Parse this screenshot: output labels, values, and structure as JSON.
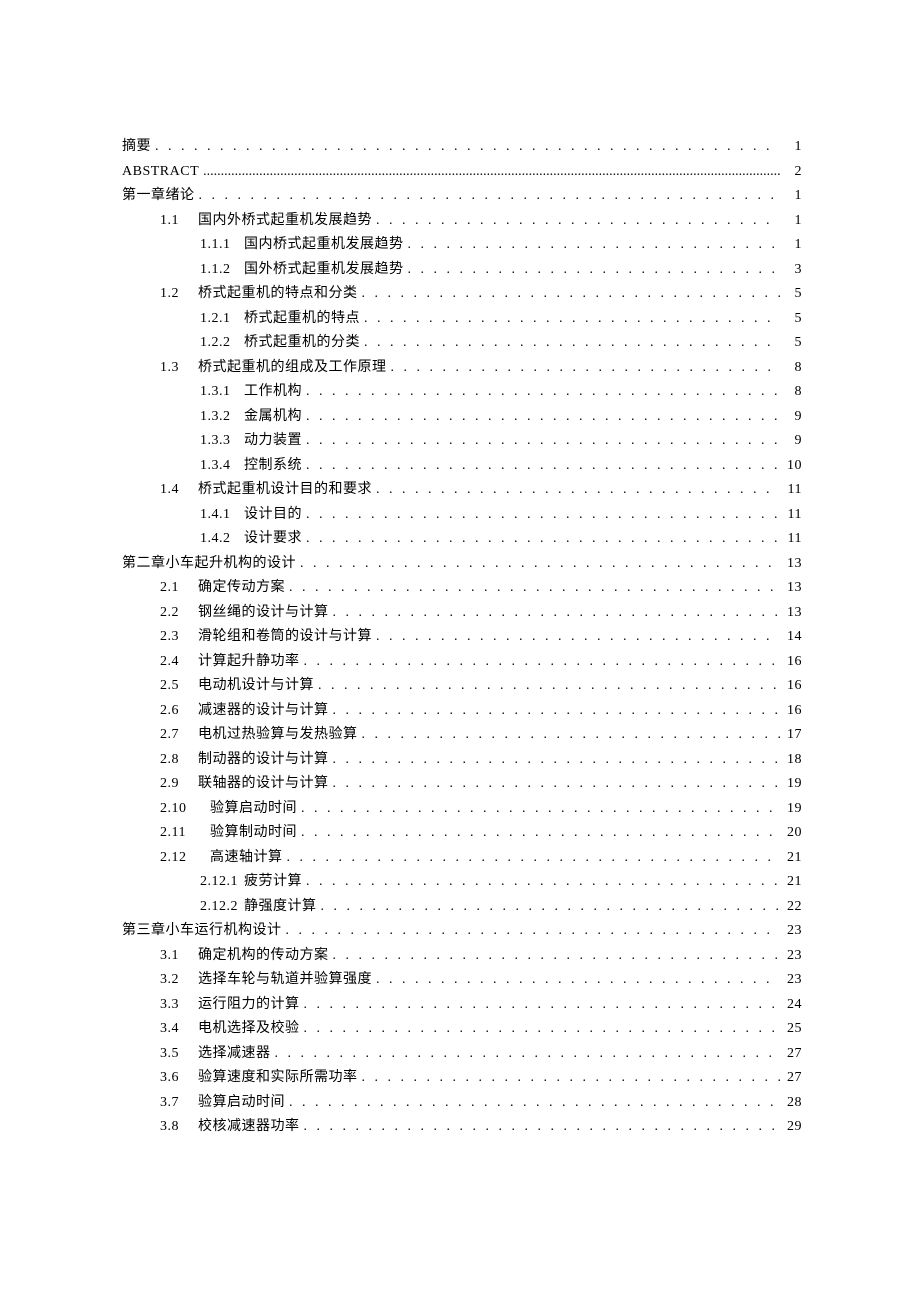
{
  "toc": {
    "entries": [
      {
        "level": 0,
        "num": "",
        "title": "摘要",
        "page": "1",
        "join": true
      },
      {
        "level": 0,
        "num": "",
        "title": "ABSTRACT",
        "page": "2",
        "join": true,
        "fine": true
      },
      {
        "level": 0,
        "num": "",
        "title": "第一章绪论",
        "page": "1",
        "join": true
      },
      {
        "level": 1,
        "num": "1.1",
        "title": "国内外桥式起重机发展趋势",
        "page": "1"
      },
      {
        "level": 2,
        "num": "1.1.1",
        "title": "国内桥式起重机发展趋势",
        "page": "1"
      },
      {
        "level": 2,
        "num": "1.1.2",
        "title": "国外桥式起重机发展趋势",
        "page": "3"
      },
      {
        "level": 1,
        "num": "1.2",
        "title": "桥式起重机的特点和分类",
        "page": "5"
      },
      {
        "level": 2,
        "num": "1.2.1",
        "title": "桥式起重机的特点",
        "page": "5"
      },
      {
        "level": 2,
        "num": "1.2.2",
        "title": "桥式起重机的分类",
        "page": "5"
      },
      {
        "level": 1,
        "num": "1.3",
        "title": "桥式起重机的组成及工作原理",
        "page": "8"
      },
      {
        "level": 2,
        "num": "1.3.1",
        "title": "工作机构",
        "page": "8"
      },
      {
        "level": 2,
        "num": "1.3.2",
        "title": "金属机构",
        "page": "9"
      },
      {
        "level": 2,
        "num": "1.3.3",
        "title": "动力装置",
        "page": "9"
      },
      {
        "level": 2,
        "num": "1.3.4",
        "title": "控制系统",
        "page": "10"
      },
      {
        "level": 1,
        "num": "1.4",
        "title": "桥式起重机设计目的和要求",
        "page": "11"
      },
      {
        "level": 2,
        "num": "1.4.1",
        "title": "设计目的",
        "page": "11"
      },
      {
        "level": 2,
        "num": "1.4.2",
        "title": "设计要求",
        "page": "11"
      },
      {
        "level": 0,
        "num": "",
        "title": "第二章小车起升机构的设计",
        "page": "13",
        "join": true
      },
      {
        "level": 1,
        "num": "2.1",
        "title": "确定传动方案",
        "page": "13"
      },
      {
        "level": 1,
        "num": "2.2",
        "title": "钢丝绳的设计与计算",
        "page": "13"
      },
      {
        "level": 1,
        "num": "2.3",
        "title": "滑轮组和卷筒的设计与计算",
        "page": "14"
      },
      {
        "level": 1,
        "num": "2.4",
        "title": "计算起升静功率",
        "page": "16"
      },
      {
        "level": 1,
        "num": "2.5",
        "title": "电动机设计与计算",
        "page": "16"
      },
      {
        "level": 1,
        "num": "2.6",
        "title": "减速器的设计与计算",
        "page": "16"
      },
      {
        "level": 1,
        "num": "2.7",
        "title": "电机过热验算与发热验算",
        "page": "17"
      },
      {
        "level": 1,
        "num": "2.8",
        "title": "制动器的设计与计算",
        "page": "18"
      },
      {
        "level": 1,
        "num": "2.9",
        "title": "联轴器的设计与计算",
        "page": "19"
      },
      {
        "level": 1,
        "num": "2.10",
        "title": "验算启动时间",
        "page": "19",
        "wide": true
      },
      {
        "level": 1,
        "num": "2.11",
        "title": "验算制动时间",
        "page": "20",
        "wide": true
      },
      {
        "level": 1,
        "num": "2.12",
        "title": "高速轴计算",
        "page": "21",
        "wide": true
      },
      {
        "level": 2,
        "num": "2.12.1",
        "title": "疲劳计算",
        "page": "21",
        "wide": true
      },
      {
        "level": 2,
        "num": "2.12.2",
        "title": "静强度计算",
        "page": "22",
        "wide": true
      },
      {
        "level": 0,
        "num": "",
        "title": "第三章小车运行机构设计",
        "page": "23",
        "join": true
      },
      {
        "level": 1,
        "num": "3.1",
        "title": "确定机构的传动方案",
        "page": "23"
      },
      {
        "level": 1,
        "num": "3.2",
        "title": "选择车轮与轨道并验算强度",
        "page": "23"
      },
      {
        "level": 1,
        "num": "3.3",
        "title": "运行阻力的计算",
        "page": "24"
      },
      {
        "level": 1,
        "num": "3.4",
        "title": "电机选择及校验",
        "page": "25"
      },
      {
        "level": 1,
        "num": "3.5",
        "title": "选择减速器",
        "page": "27"
      },
      {
        "level": 1,
        "num": "3.6",
        "title": "验算速度和实际所需功率",
        "page": "27"
      },
      {
        "level": 1,
        "num": "3.7",
        "title": "验算启动时间",
        "page": "28"
      },
      {
        "level": 1,
        "num": "3.8",
        "title": "校核减速器功率",
        "page": "29"
      }
    ]
  }
}
